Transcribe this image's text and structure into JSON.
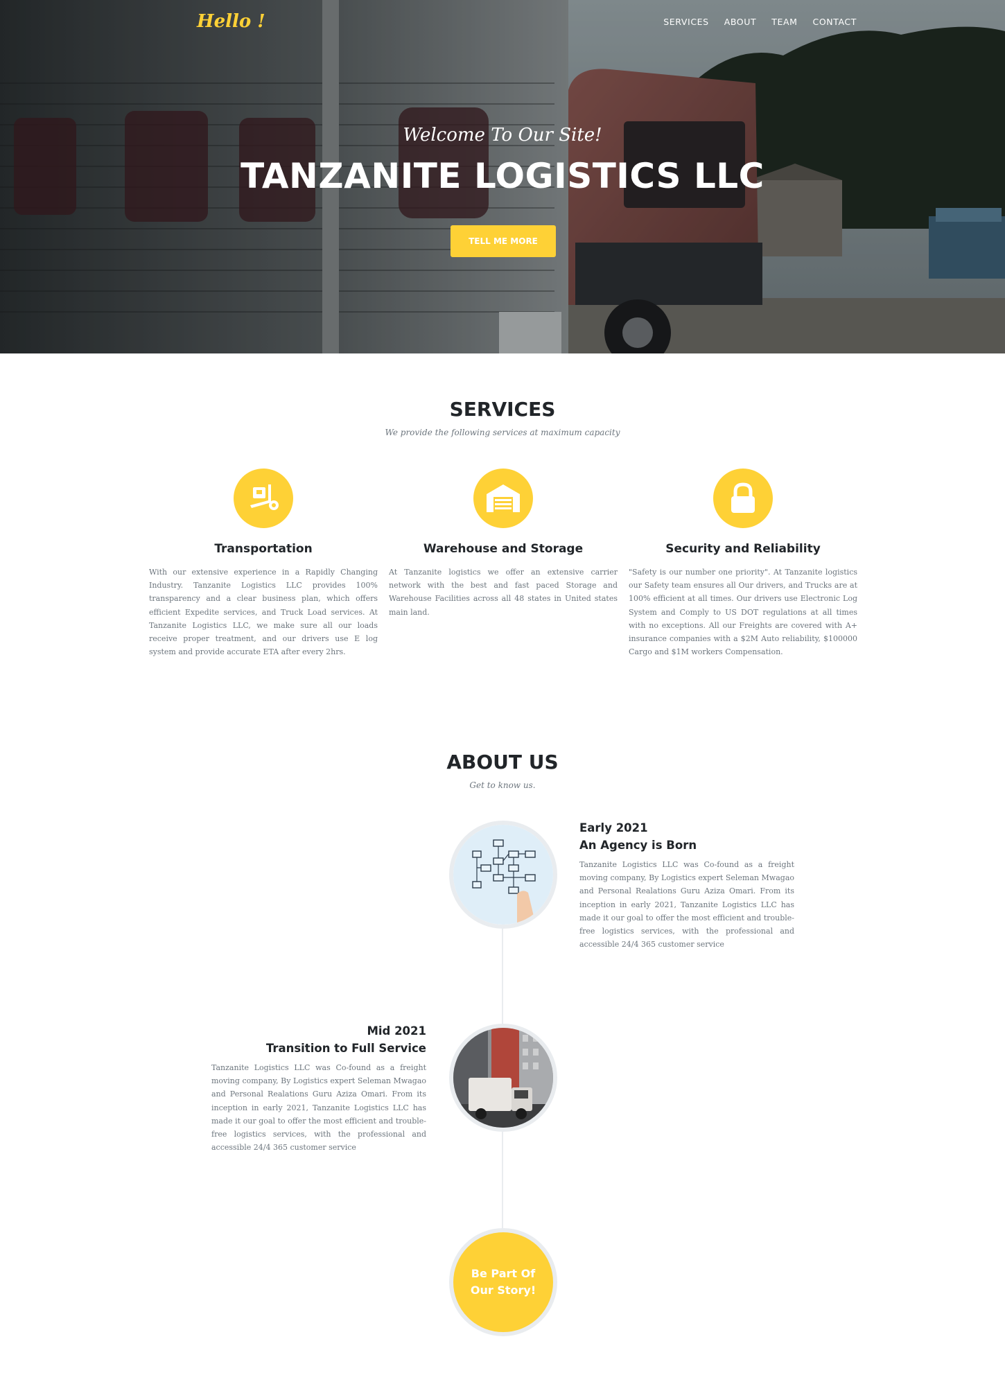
{
  "nav": {
    "brand": "Hello !",
    "links": [
      "SERVICES",
      "ABOUT",
      "TEAM",
      "CONTACT"
    ]
  },
  "hero": {
    "subheading": "Welcome To Our Site!",
    "heading": "TANZANITE LOGISTICS LLC",
    "button": "TELL ME MORE"
  },
  "services": {
    "title": "SERVICES",
    "subtitle": "We provide the following services at maximum capacity",
    "items": [
      {
        "icon": "dolly-icon",
        "title": "Transportation",
        "text": "With our extensive experience in a Rapidly Changing Industry. Tanzanite Logistics LLC provides 100% transparency and a clear business plan, which offers efficient Expedite services, and Truck Load services. At Tanzanite Logistics LLC, we make sure all our loads receive proper treatment, and our drivers use E log system and provide accurate ETA after every 2hrs."
      },
      {
        "icon": "warehouse-icon",
        "title": "Warehouse and Storage",
        "text": "At Tanzanite logistics we offer an extensive carrier network with the best and fast paced Storage and Warehouse Facilities across all 48 states in United states main land."
      },
      {
        "icon": "lock-icon",
        "title": "Security and Reliability",
        "text": "\"Safety is our number one priority\". At Tanzanite logistics our Safety team ensures all Our drivers, and Trucks are at 100% efficient at all times. Our drivers use Electronic Log System and Comply to US DOT regulations at all times with no exceptions. All our Freights are covered with A+ insurance companies with a $2M Auto reliability, $100000 Cargo and $1M workers Compensation."
      }
    ]
  },
  "about": {
    "title": "ABOUT US",
    "subtitle": "Get to know us.",
    "timeline": [
      {
        "date": "Early 2021",
        "heading": "An Agency is Born",
        "text": "Tanzanite Logistics LLC was Co-found as a freight moving company, By Logistics expert Seleman Mwagao and Personal Realations Guru Aziza Omari. From its inception in early 2021, Tanzanite Logistics LLC has made it our goal to offer the most efficient and trouble-free logistics services, with the professional and accessible 24/4 365 customer service"
      },
      {
        "date": "Mid 2021",
        "heading": "Transition to Full Service",
        "text": "Tanzanite Logistics LLC was Co-found as a freight moving company, By Logistics expert Seleman Mwagao and Personal Realations Guru Aziza Omari. From its inception in early 2021, Tanzanite Logistics LLC has made it our goal to offer the most efficient and trouble-free logistics services, with the professional and accessible 24/4 365 customer service"
      }
    ],
    "end_badge": "Be Part Of Our Story!"
  },
  "colors": {
    "accent": "#fed136",
    "heading": "#212529",
    "muted": "#6c757d",
    "timeline_line": "#e9ecef"
  }
}
